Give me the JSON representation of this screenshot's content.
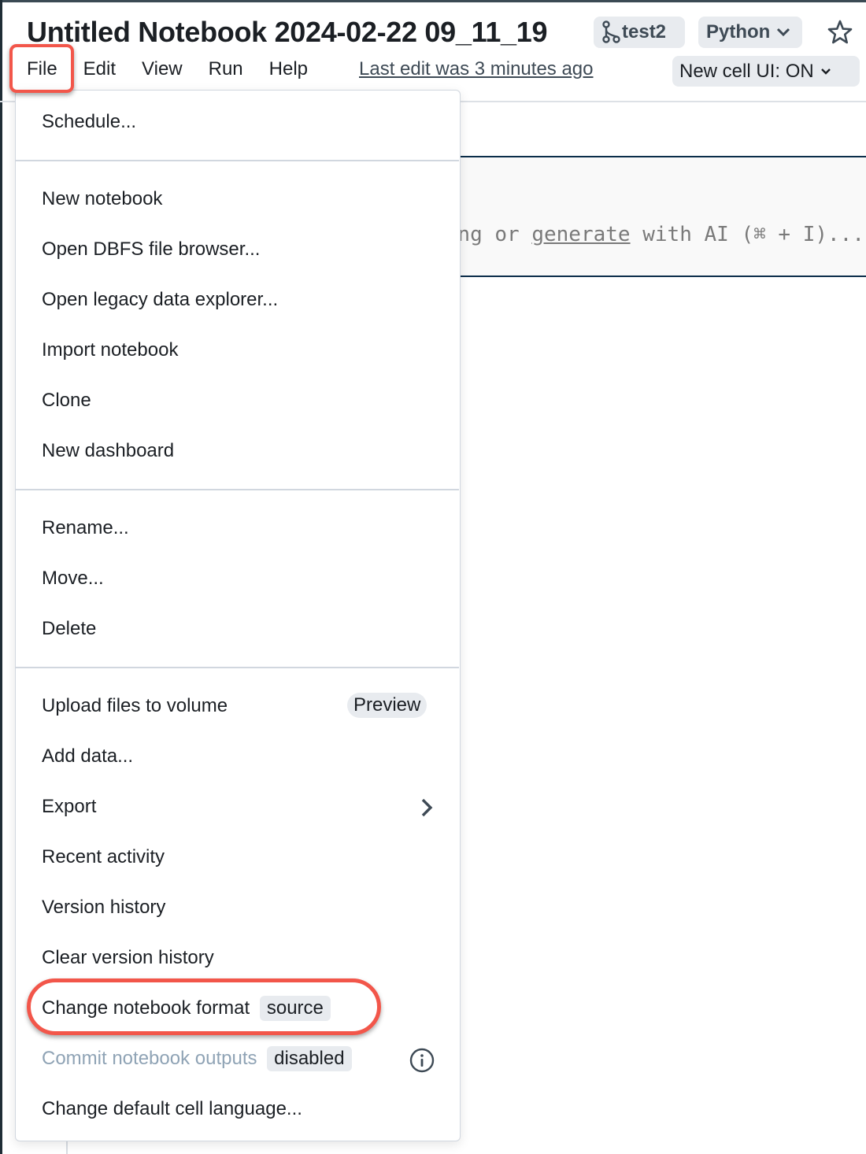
{
  "header": {
    "title": "Untitled Notebook 2024-02-22 09_11_19",
    "branch": "test2",
    "language": "Python",
    "last_edit": "Last edit was 3 minutes ago",
    "cell_ui": "New cell UI: ON"
  },
  "menubar": {
    "items": [
      "File",
      "Edit",
      "View",
      "Run",
      "Help"
    ],
    "active": "File"
  },
  "cell": {
    "placeholder_prefix": "ng or ",
    "placeholder_link": "generate",
    "placeholder_suffix": " with AI (⌘ + I)..."
  },
  "file_menu": {
    "groups": [
      [
        "Schedule..."
      ],
      [
        "New notebook",
        "Open DBFS file browser...",
        "Open legacy data explorer...",
        "Import notebook",
        "Clone",
        "New dashboard"
      ],
      [
        "Rename...",
        "Move...",
        "Delete"
      ],
      [
        "Upload files to volume",
        "Add data...",
        "Export",
        "Recent activity",
        "Version history",
        "Clear version history",
        "Change notebook format",
        "Commit notebook outputs",
        "Change default cell language..."
      ]
    ],
    "upload_badge": "Preview",
    "format_badge": "source",
    "commit_badge": "disabled"
  },
  "colors": {
    "highlight": "#f2564a",
    "chip_bg": "#e8ebef",
    "disabled_text": "#8fa3b5",
    "cell_border": "#0b2d4a"
  },
  "icons": {
    "branch": "git-branch-icon",
    "language_chevron": "chevron-down-icon",
    "favorite": "star-icon",
    "export_submenu": "chevron-right-icon",
    "commit_info": "info-icon"
  }
}
